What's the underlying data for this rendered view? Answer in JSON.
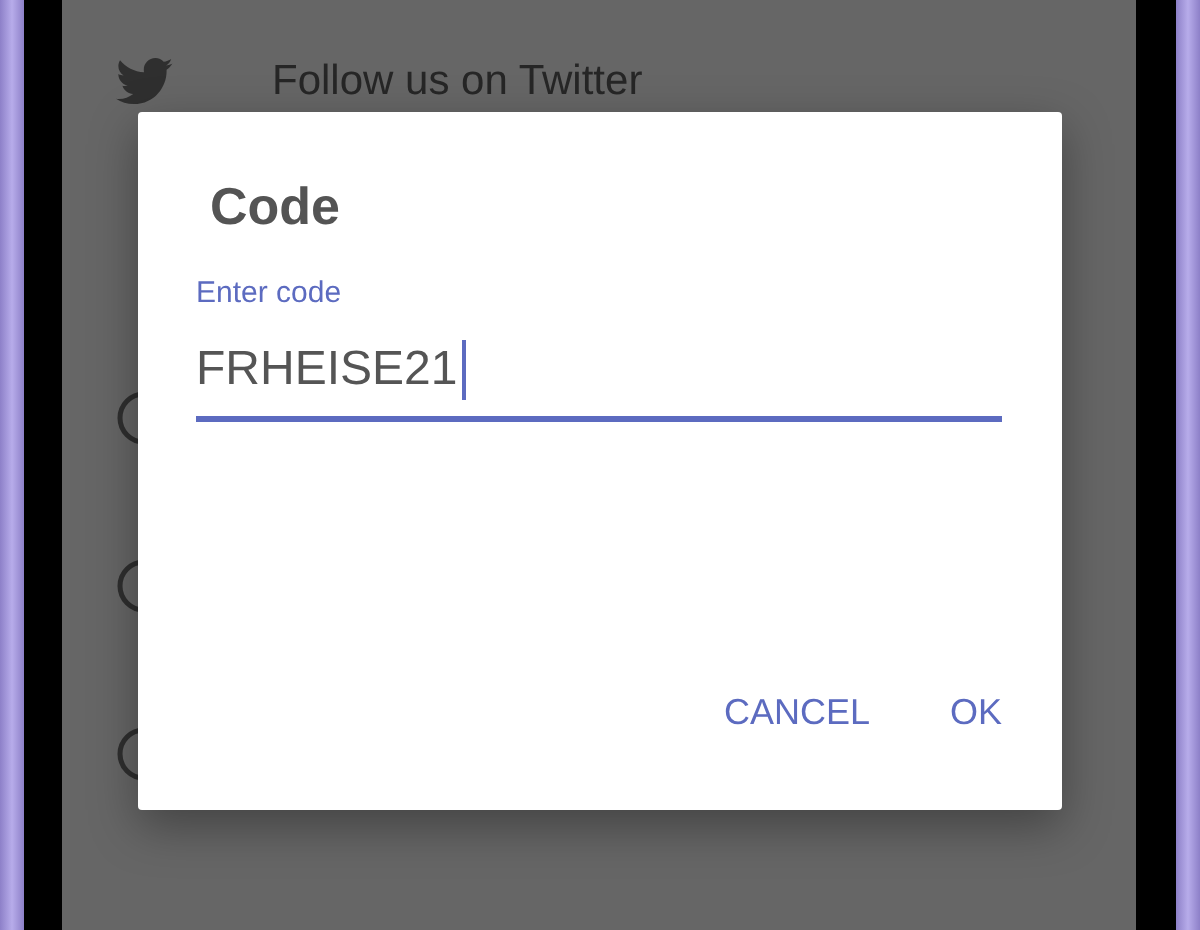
{
  "background": {
    "rows": [
      {
        "kind": "twitter",
        "label": "Follow us on Twitter"
      },
      {
        "kind": "circle"
      },
      {
        "kind": "circle"
      },
      {
        "kind": "circle"
      }
    ]
  },
  "dialog": {
    "title": "Code",
    "field": {
      "label": "Enter code",
      "value": "FRHEISE21",
      "focused": true
    },
    "buttons": [
      "CANCEL",
      "OK"
    ]
  }
}
